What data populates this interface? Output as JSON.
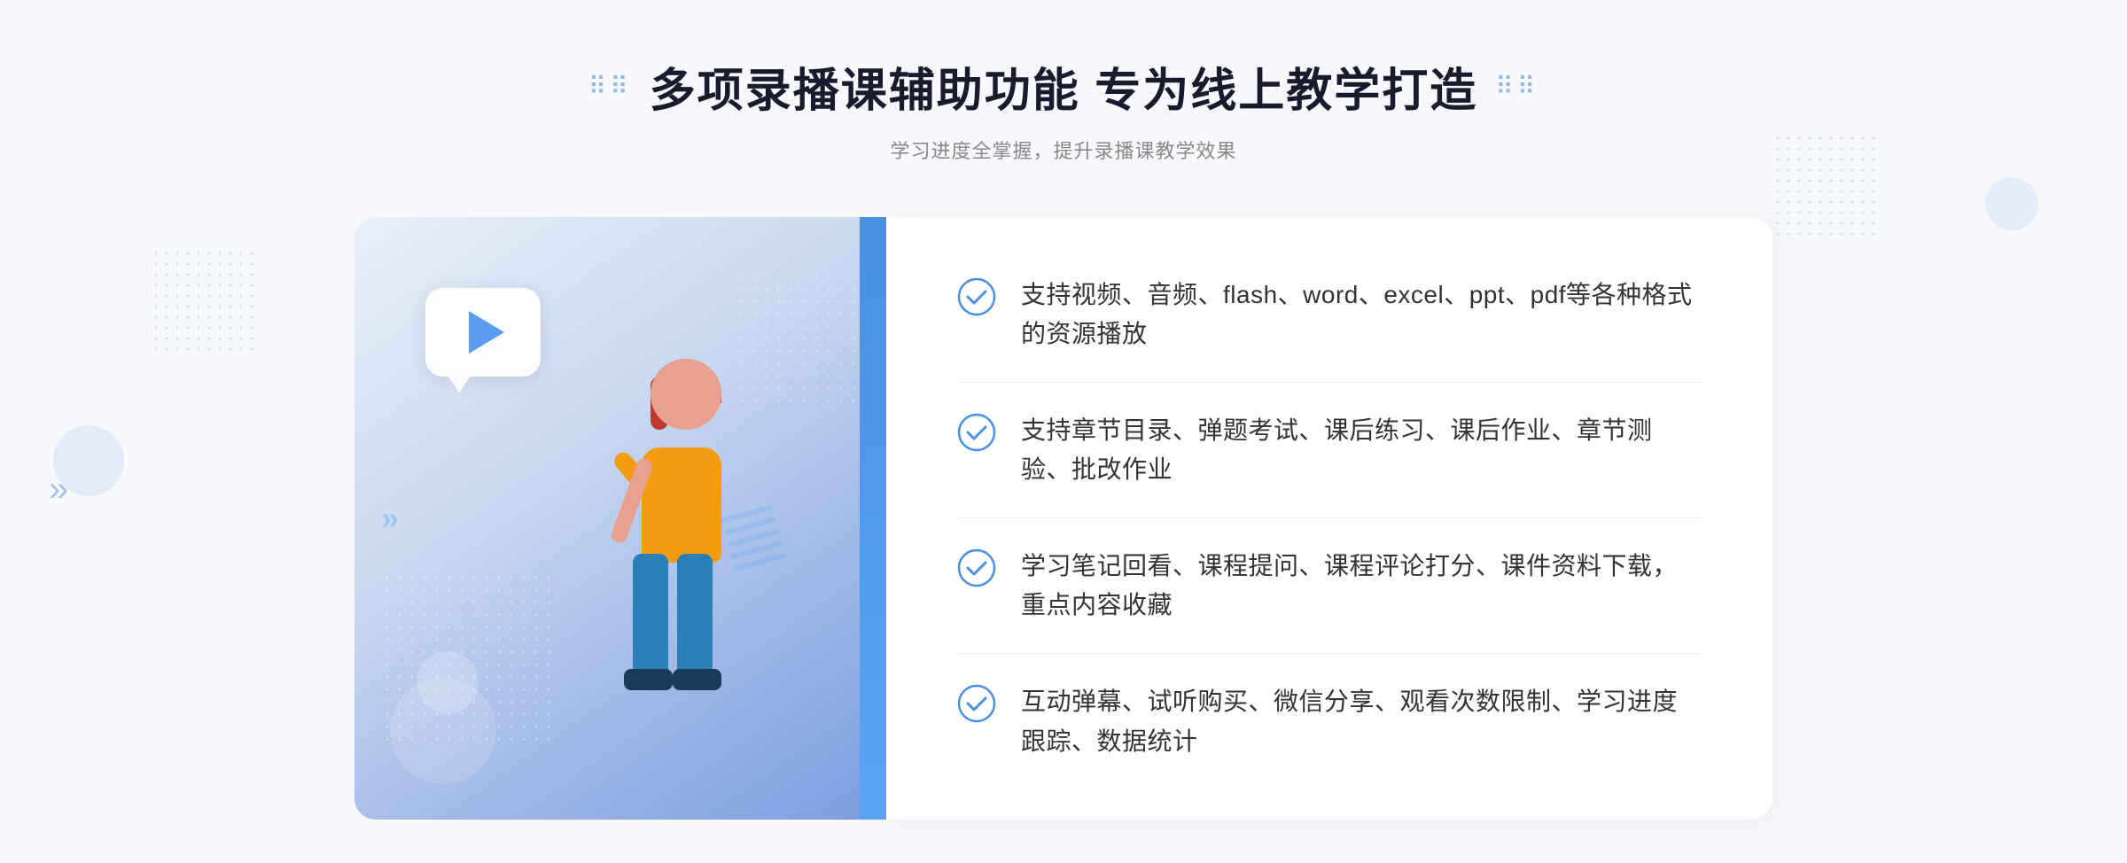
{
  "header": {
    "title": "多项录播课辅助功能 专为线上教学打造",
    "subtitle": "学习进度全掌握，提升录播课教学效果",
    "decorative_left": "⠿⠿",
    "decorative_right": "⠿⠿"
  },
  "features": [
    {
      "id": 1,
      "text": "支持视频、音频、flash、word、excel、ppt、pdf等各种格式的资源播放"
    },
    {
      "id": 2,
      "text": "支持章节目录、弹题考试、课后练习、课后作业、章节测验、批改作业"
    },
    {
      "id": 3,
      "text": "学习笔记回看、课程提问、课程评论打分、课件资料下载，重点内容收藏"
    },
    {
      "id": 4,
      "text": "互动弹幕、试听购买、微信分享、观看次数限制、学习进度跟踪、数据统计"
    }
  ],
  "check_icon": {
    "color": "#4a90e2"
  }
}
